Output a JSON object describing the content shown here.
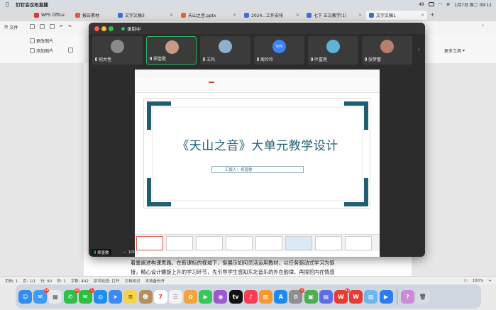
{
  "menubar": {
    "app_name": "钉钉会议布直播",
    "date_time": "1月7日 周二 09:11",
    "battery_pct": "48"
  },
  "wps_tabs": [
    {
      "label": "WPS Office",
      "color": "#d63b2e"
    },
    {
      "label": "报告素材",
      "color": "#e05a4a"
    },
    {
      "label": "文字文稿3",
      "color": "#3b6fe0"
    },
    {
      "label": "天山之音.pptx",
      "color": "#e0682c"
    },
    {
      "label": "2024...工作安排",
      "color": "#3b6fe0"
    },
    {
      "label": "七下 正文教学(1)",
      "color": "#3b6fe0"
    },
    {
      "label": "文字文稿1",
      "color": "#3b6fe0"
    }
  ],
  "toolbar": {
    "file_label": "文件",
    "change_image": "更改图片",
    "add_image": "添加图片",
    "more_tools": "更多工具"
  },
  "doc": {
    "line1": "着重阐述构课思路。在新课标的视域下，挺展示如何灵活运用教材，以任务驱动式学习为驱",
    "line2": "接，精心设计螺旋上升的学习环节，先引导学生感知东北音乐的外在韵律，再探挖内在情感"
  },
  "statusbar": {
    "page": "页码: 1",
    "pages": "页: 1/1",
    "line": "行: 90",
    "col": "列: 1",
    "words": "字数: 442",
    "spell": "拼写检查: 打开",
    "proof": "文档校对",
    "backup": "本地备份开",
    "zoom": "160%"
  },
  "recording": {
    "title": "录制中",
    "participants": [
      {
        "name": "何大性",
        "avatar": "#8a8a8a",
        "active": false
      },
      {
        "name": "郑壹歌",
        "avatar": "#c79a86",
        "active": true
      },
      {
        "name": "王玛",
        "avatar": "#8fb0c9",
        "active": false
      },
      {
        "name": "周玲玲",
        "avatar": "#3b82f6",
        "initials": "玲玲",
        "active": false
      },
      {
        "name": "叶富莲",
        "avatar": "#5fb3d9",
        "active": false
      },
      {
        "name": "张梦蕾",
        "avatar": "#b57f6c",
        "active": false
      }
    ],
    "presenter": "郑壹歌",
    "shared_zoom": "100%"
  },
  "slide": {
    "title": "《天山之音》大单元教学设计",
    "reporter": "汇报人：郑壹歌"
  },
  "dock_apps": [
    {
      "name": "finder",
      "color": "#2f8cf0",
      "badge": ""
    },
    {
      "name": "mail",
      "color": "#3d9bf3",
      "badge": "58"
    },
    {
      "name": "launchpad",
      "color": "#e8e8e8",
      "badge": ""
    },
    {
      "name": "messages",
      "color": "#30c04a",
      "badge": "52"
    },
    {
      "name": "wechat",
      "color": "#2dbf40",
      "badge": "1"
    },
    {
      "name": "safari",
      "color": "#1f8ef0",
      "badge": ""
    },
    {
      "name": "dingtalk",
      "color": "#3b8af6",
      "badge": ""
    },
    {
      "name": "notes",
      "color": "#f5d34a",
      "badge": ""
    },
    {
      "name": "contacts",
      "color": "#b78d5a",
      "badge": ""
    },
    {
      "name": "calendar",
      "color": "#ffffff",
      "badge": ""
    },
    {
      "name": "reminders",
      "color": "#f2f2f2",
      "badge": ""
    },
    {
      "name": "photos",
      "color": "#f4a23b",
      "badge": ""
    },
    {
      "name": "facetime",
      "color": "#34c759",
      "badge": ""
    },
    {
      "name": "podcasts",
      "color": "#9b59d0",
      "badge": ""
    },
    {
      "name": "tv",
      "color": "#111111",
      "badge": ""
    },
    {
      "name": "music",
      "color": "#fb3c57",
      "badge": ""
    },
    {
      "name": "books",
      "color": "#f79a2e",
      "badge": ""
    },
    {
      "name": "app-store",
      "color": "#1b8df2",
      "badge": ""
    },
    {
      "name": "settings",
      "color": "#8e8e93",
      "badge": "1"
    },
    {
      "name": "app-generic",
      "color": "#4caf50",
      "badge": ""
    },
    {
      "name": "app-generic-2",
      "color": "#5b6ee1",
      "badge": ""
    },
    {
      "name": "wps",
      "color": "#e43d30",
      "badge": "11"
    },
    {
      "name": "wps-2",
      "color": "#e43d30",
      "badge": ""
    },
    {
      "name": "preview",
      "color": "#6cb6f2",
      "badge": ""
    },
    {
      "name": "tencent-meeting",
      "color": "#2a7ef5",
      "badge": ""
    },
    {
      "name": "help",
      "color": "#c98bd8",
      "badge": ""
    },
    {
      "name": "trash",
      "color": "#d9dde3",
      "badge": ""
    }
  ],
  "colors": {
    "slide_accent": "#1f5f73",
    "tab_wps": "#d63b2e"
  }
}
